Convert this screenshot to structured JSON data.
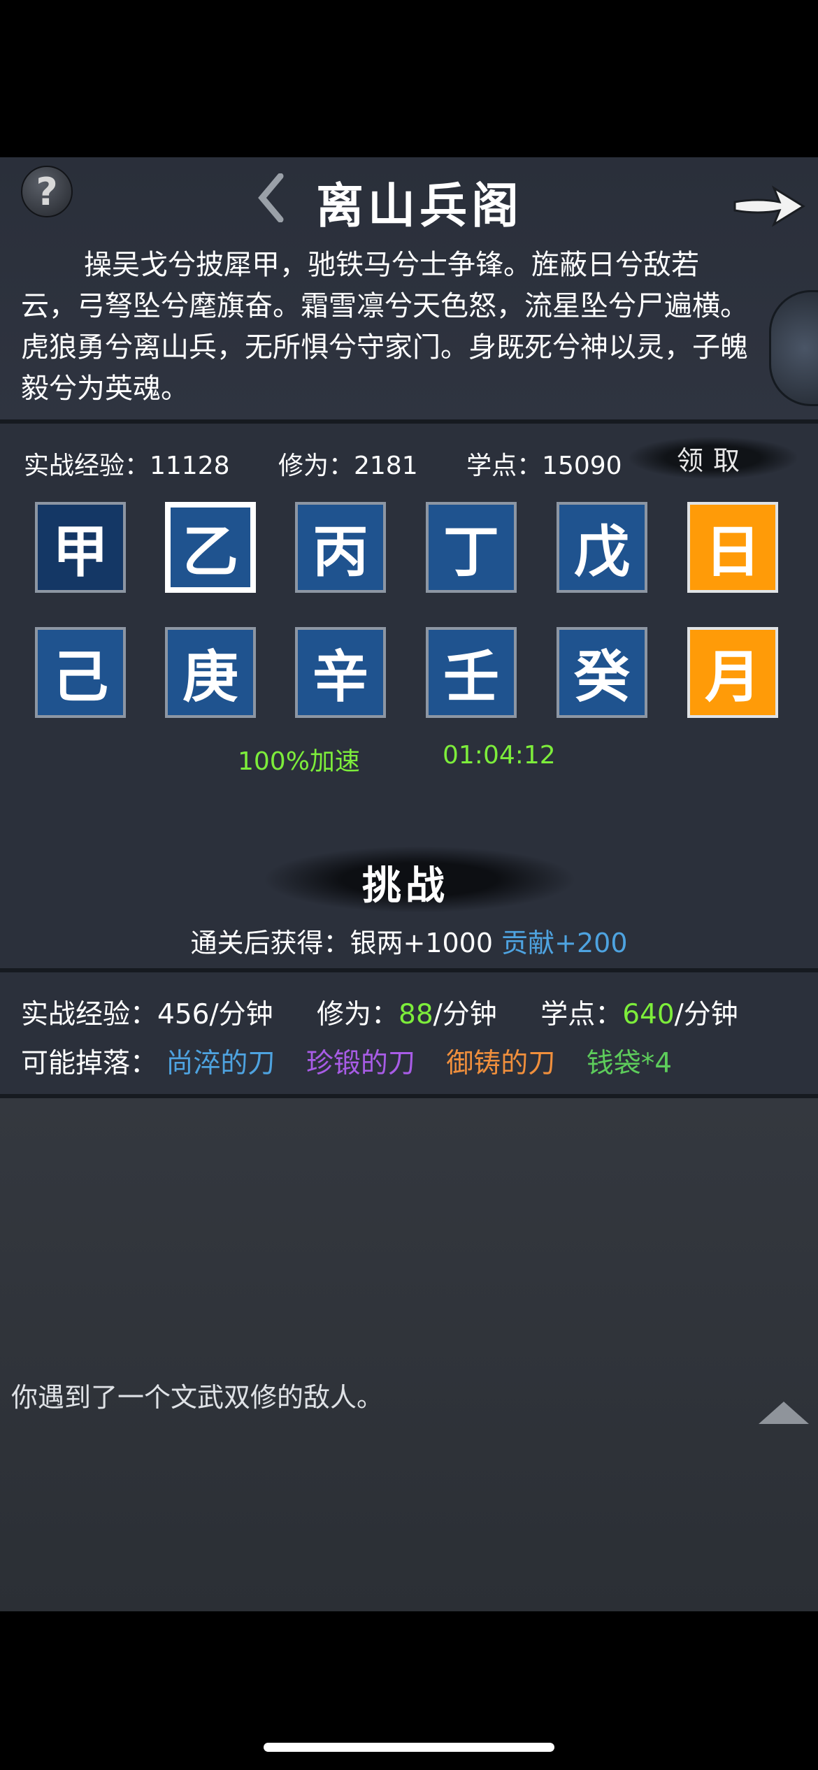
{
  "header": {
    "title": "离山兵阁",
    "poem": "操吴戈兮披犀甲，驰铁马兮士争锋。旌蔽日兮敌若云，弓弩坠兮麾旗奋。霜雪凛兮天色怒，流星坠兮尸遍横。虎狼勇兮离山兵，无所惧兮守家门。身既死兮神以灵，子魄毅兮为英魂。"
  },
  "stats": {
    "combat_exp": "实战经验：11128",
    "cultivation": "修为：2181",
    "study_points": "学点：15090",
    "claim_label": "领取"
  },
  "tiles": {
    "row1": [
      "甲",
      "乙",
      "丙",
      "丁",
      "戊",
      "日"
    ],
    "row2": [
      "己",
      "庚",
      "辛",
      "壬",
      "癸",
      "月"
    ]
  },
  "boost": {
    "accel": "100%加速",
    "timer": "01:04:12"
  },
  "challenge": {
    "label": "挑战",
    "reward_prefix": "通关后获得：银两+1000",
    "reward_extra": "贡献+200"
  },
  "rates": {
    "exp_label": "实战经验：456/分钟",
    "cult_label": "修为：",
    "cult_value": "88",
    "cult_unit": "/分钟",
    "study_label": "学点：",
    "study_value": "640",
    "study_unit": "/分钟"
  },
  "drops": {
    "label": "可能掉落：",
    "items": [
      "尚淬的刀",
      "珍锻的刀",
      "御铸的刀",
      "钱袋*4"
    ],
    "colors": [
      "#4ea3e0",
      "#a85ce6",
      "#f08f3c",
      "#5dcc5b"
    ]
  },
  "log": {
    "message": "你遇到了一个文武双修的敌人。"
  },
  "icons": [
    "help-icon",
    "back-arrow-icon",
    "forward-arrow-icon",
    "scroll-up-icon"
  ],
  "colors": {
    "tile_blue": "#1f538f",
    "tile_gold": "#ff9b08",
    "green": "#7ded3b",
    "blue": "#4ea3e0"
  }
}
